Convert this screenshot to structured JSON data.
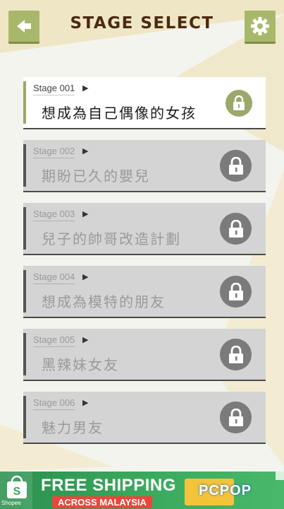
{
  "header": {
    "title": "STAGE SELECT"
  },
  "stages": [
    {
      "number": "Stage 001",
      "name": "想成為自己偶像的女孩",
      "active": true
    },
    {
      "number": "Stage 002",
      "name": "期盼已久的嬰兒",
      "active": false
    },
    {
      "number": "Stage 003",
      "name": "兒子的帥哥改造計劃",
      "active": false
    },
    {
      "number": "Stage 004",
      "name": "想成為模特的朋友",
      "active": false
    },
    {
      "number": "Stage 005",
      "name": "黑辣妹女友",
      "active": false
    },
    {
      "number": "Stage 006",
      "name": "魅力男友",
      "active": false
    }
  ],
  "ad": {
    "line1": "FREE SHIPPING",
    "line2": "ACROSS MALAYSIA",
    "brand": "Shopee",
    "watermark": "PCPOP"
  },
  "icons": {
    "back": "back-arrow-icon",
    "settings": "gear-icon",
    "lock": "lock-icon",
    "play": "play-triangle-icon"
  },
  "colors": {
    "accent": "#a8b86a",
    "title": "#4a2a10",
    "locked_card": "#d4d4d4",
    "lock_circle": "#7b7b7b",
    "background": "#f4f4ee",
    "ad_green": "#3aa95d"
  }
}
